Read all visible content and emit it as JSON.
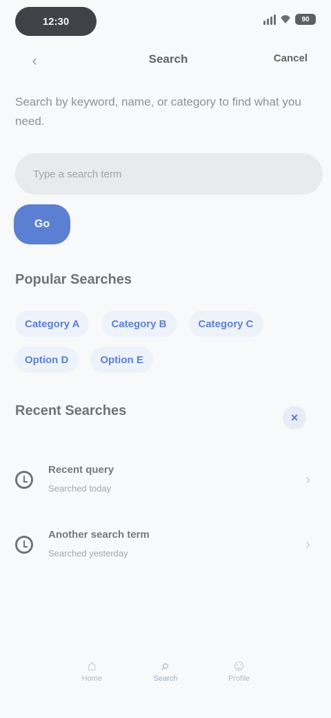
{
  "status_bar": {
    "time": "12:30",
    "battery": "90"
  },
  "nav": {
    "back_icon": "chevron-left-icon",
    "title": "Search",
    "action": "Cancel"
  },
  "prompt": "Search by keyword, name, or category to find what you need.",
  "search": {
    "placeholder": "Type a search term",
    "button_label": "Go"
  },
  "popular": {
    "title": "Popular Searches",
    "chips": [
      "Category A",
      "Category B",
      "Category C",
      "Option D",
      "Option E"
    ]
  },
  "recent": {
    "title": "Recent Searches",
    "clear_icon": "clear-icon",
    "items": [
      {
        "query": "Recent query",
        "meta": "Searched today",
        "icon": "history-icon"
      },
      {
        "query": "Another search term",
        "meta": "Searched yesterday",
        "icon": "history-icon"
      }
    ]
  },
  "bottom_nav": {
    "items": [
      {
        "label": "Home",
        "icon": "home-icon"
      },
      {
        "label": "Search",
        "icon": "search-icon"
      },
      {
        "label": "Profile",
        "icon": "profile-icon"
      }
    ]
  },
  "colors": {
    "accent": "#5b7fd2",
    "background": "#f8f9fa",
    "field": "#e9eaec"
  }
}
